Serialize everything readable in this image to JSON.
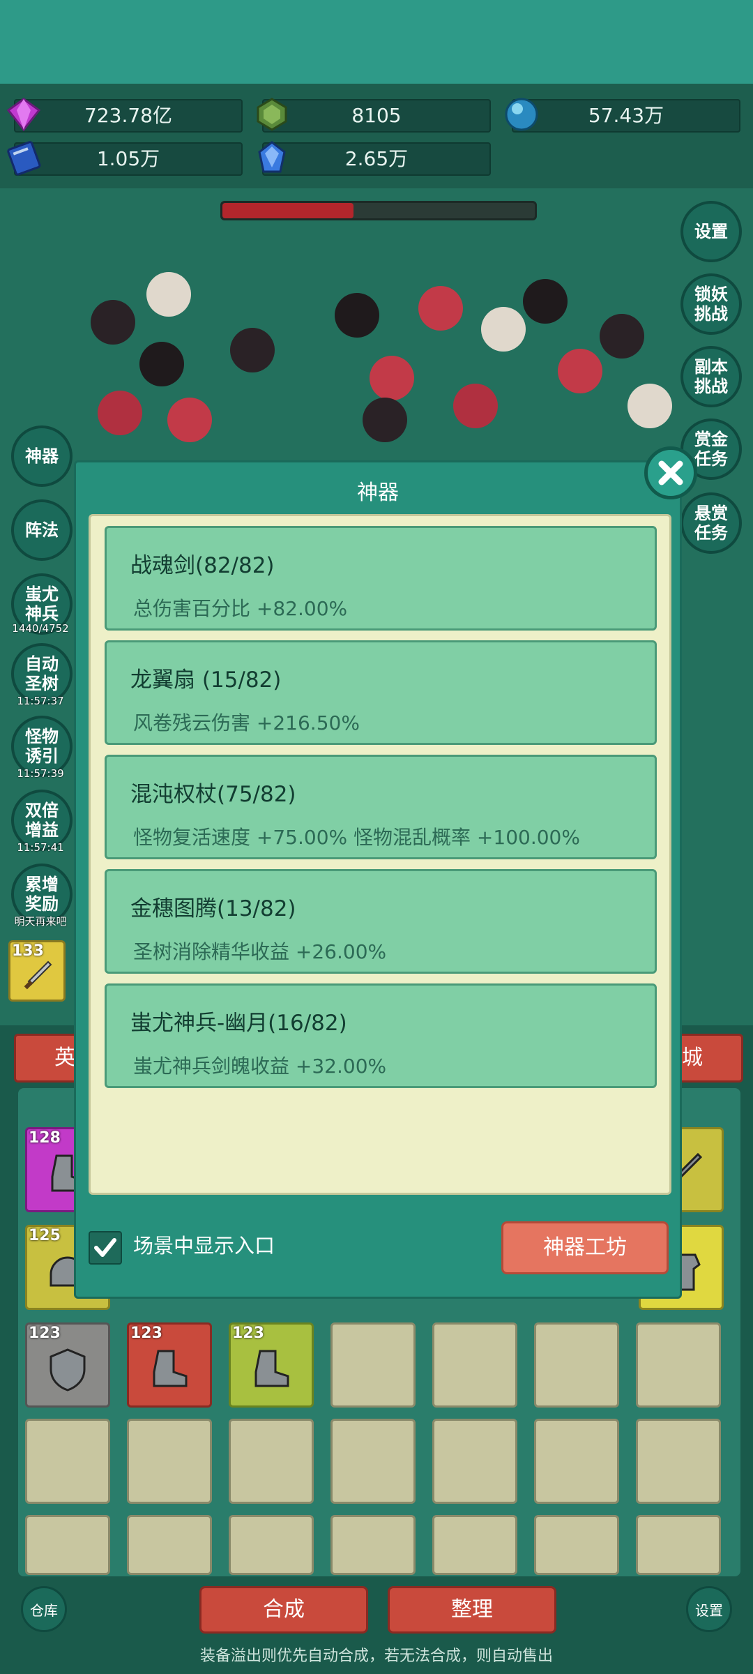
{
  "resources": {
    "gem": "723.78亿",
    "green_gem": "8105",
    "orb": "57.43万",
    "book": "1.05万",
    "crystal": "2.65万"
  },
  "battle": {
    "boss_hp_fraction": 0.42,
    "right_buttons": [
      "设置",
      "锁妖\n挑战",
      "副本\n挑战",
      "赏金\n任务",
      "悬赏\n任务"
    ],
    "left_buttons": [
      {
        "label": "神器",
        "timer": ""
      },
      {
        "label": "阵法",
        "timer": ""
      },
      {
        "label": "蚩尤\n神兵",
        "timer": "1440/4752"
      },
      {
        "label": "自动\n圣树",
        "timer": "11:57:37"
      },
      {
        "label": "怪物\n诱引",
        "timer": "11:57:39"
      },
      {
        "label": "双倍\n增益",
        "timer": "11:57:41"
      },
      {
        "label": "累增\n奖励",
        "timer": "明天再来吧"
      }
    ],
    "hero_level": "133"
  },
  "bottom": {
    "tab_left": "英",
    "tab_right": "城",
    "merge_button": "合成",
    "sort_button": "整理",
    "warehouse_button": "仓库",
    "settings_button": "设置",
    "footnote": "装备溢出则优先自动合成，若无法合成，则自动售出",
    "grid_levels": [
      "128",
      "125",
      "123",
      "123",
      "123"
    ]
  },
  "modal": {
    "title": "神器",
    "artifacts": [
      {
        "name": "战魂剑(82/82)",
        "effect": "总伤害百分比 +82.00%"
      },
      {
        "name": "龙翼扇 (15/82)",
        "effect": "风卷残云伤害 +216.50%"
      },
      {
        "name": "混沌权杖(75/82)",
        "effect": "怪物复活速度 +75.00% 怪物混乱概率 +100.00%"
      },
      {
        "name": "金穗图腾(13/82)",
        "effect": "圣树消除精华收益 +26.00%"
      },
      {
        "name": "蚩尤神兵-幽月(16/82)",
        "effect": "蚩尤神兵剑魄收益 +32.00%"
      }
    ],
    "show_entry_label": "场景中显示入口",
    "show_entry_checked": true,
    "workshop_button": "神器工坊"
  },
  "colors": {
    "accent_red": "#c94a3c",
    "modal_teal": "#26907c",
    "card_green": "#80cfa5"
  }
}
